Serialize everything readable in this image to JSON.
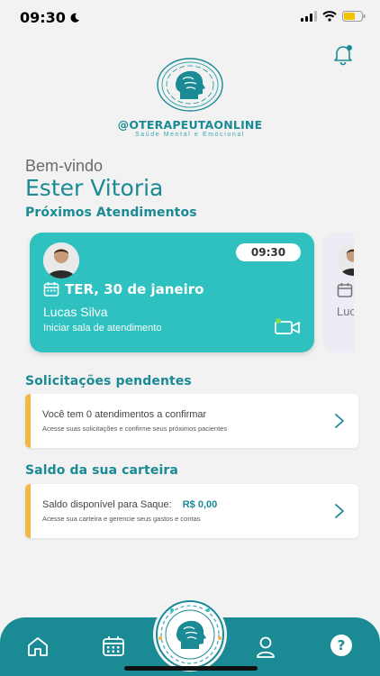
{
  "status_bar": {
    "time": "09:30"
  },
  "brand": {
    "name": "@OTERAPEUTAONLINE",
    "tagline": "Saúde Mental e Emocional"
  },
  "greeting": {
    "welcome": "Bem-vindo",
    "user_name": "Ester Vitoria"
  },
  "appointments": {
    "title": "Próximos Atendimentos",
    "items": [
      {
        "time": "09:30",
        "date": "TER, 30 de janeiro",
        "patient": "Lucas Silva",
        "action": "Iniciar sala de atendimento"
      },
      {
        "patient": "Luc"
      }
    ]
  },
  "pending": {
    "title": "Solicitações pendentes",
    "message": "Você tem 0 atendimentos a confirmar",
    "subtitle": "Acesse suas solicitações e confirme seus próximos pacientes"
  },
  "wallet": {
    "title": "Saldo da sua carteira",
    "label": "Saldo disponível para Saque:",
    "amount": "R$ 0,00",
    "subtitle": "Acesse sua carteira e gerencie seus gastos e contas"
  },
  "nav": {
    "items": [
      "home-icon",
      "calendar-icon",
      "brand-logo",
      "profile-icon",
      "help-icon"
    ],
    "help_glyph": "?"
  },
  "colors": {
    "primary": "#1a8a95",
    "card": "#2ec1c0",
    "accent": "#f4b54a",
    "background": "#f2f2f2"
  }
}
